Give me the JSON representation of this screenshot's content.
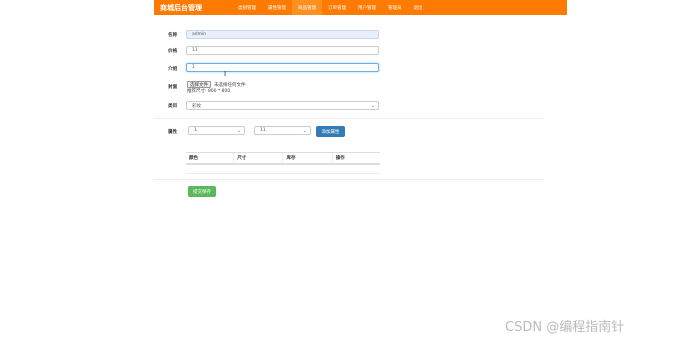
{
  "nav": {
    "brand": "商城后台管理",
    "items": [
      "类别管理",
      "属性管理",
      "商品管理",
      "订单管理",
      "用户管理",
      "管理员",
      "退出"
    ],
    "active_index": 2
  },
  "form": {
    "name_label": "名称",
    "name_value": "admin",
    "price_label": "价格",
    "price_value": "11",
    "intro_label": "介绍",
    "intro_value": "1",
    "cover_label": "封面",
    "file_button": "选择文件",
    "file_status": "未选择任何文件",
    "size_hint": "推荐尺寸: 800 * 800",
    "category_label": "类目",
    "category_value": "彩妆",
    "attr_label": "属性",
    "attr_select_1": "1",
    "attr_select_2": "11",
    "add_attr_button": "添加属性",
    "table_headers": [
      "颜色",
      "尺寸",
      "库存",
      "操作"
    ],
    "submit_button": "提交保存"
  },
  "colors": {
    "nav_bg": "#ff7a00",
    "primary": "#337ab7",
    "success": "#5cb85c"
  },
  "watermark": "CSDN @编程指南针"
}
